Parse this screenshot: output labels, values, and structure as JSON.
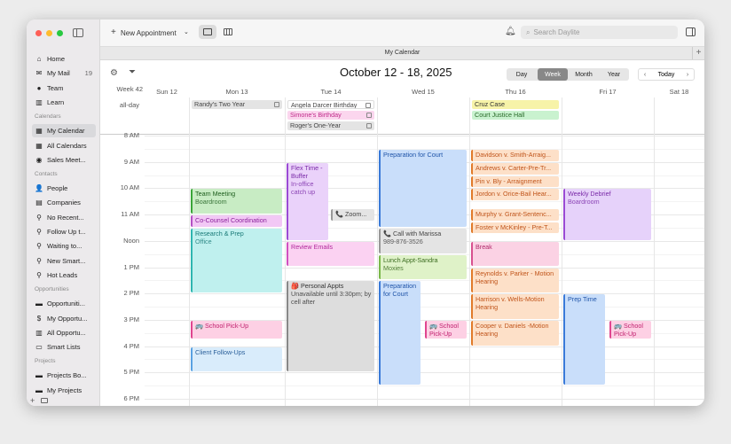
{
  "toolbar": {
    "new_appt": "New Appointment",
    "search_placeholder": "Search Daylite"
  },
  "tab": "My Calendar",
  "header": {
    "title": "October 12 - 18, 2025",
    "views": [
      "Day",
      "Week",
      "Month",
      "Year"
    ],
    "today": "Today"
  },
  "sidebar": {
    "items": [
      {
        "label": "Home",
        "icon": "⌂"
      },
      {
        "label": "My Mail",
        "icon": "✉",
        "count": "19"
      },
      {
        "label": "Team",
        "icon": "●"
      },
      {
        "label": "Learn",
        "icon": "▥"
      }
    ],
    "calendars_head": "Calendars",
    "calendars": [
      {
        "label": "My Calendar",
        "icon": "▦"
      },
      {
        "label": "All Calendars",
        "icon": "▦"
      },
      {
        "label": "Sales Meet...",
        "icon": "◉"
      }
    ],
    "contacts_head": "Contacts",
    "contacts": [
      {
        "label": "People",
        "icon": "👤"
      },
      {
        "label": "Companies",
        "icon": "▤"
      },
      {
        "label": "No Recent...",
        "icon": "⚲"
      },
      {
        "label": "Follow Up t...",
        "icon": "⚲"
      },
      {
        "label": "Waiting to...",
        "icon": "⚲"
      },
      {
        "label": "New Smart...",
        "icon": "⚲"
      },
      {
        "label": "Hot Leads",
        "icon": "⚲"
      }
    ],
    "opps_head": "Opportunities",
    "opps": [
      {
        "label": "Opportuniti...",
        "icon": "▬"
      },
      {
        "label": "My Opportu...",
        "icon": "$"
      },
      {
        "label": "All Opportu...",
        "icon": "▥"
      },
      {
        "label": "Smart Lists",
        "icon": "▭"
      }
    ],
    "projects_head": "Projects",
    "projects": [
      {
        "label": "Projects Bo...",
        "icon": "▬"
      },
      {
        "label": "My Projects",
        "icon": "▬"
      }
    ]
  },
  "week_label": "Week 42",
  "days": [
    "Sun 12",
    "Mon 13",
    "Tue 14",
    "Wed 15",
    "Thu 16",
    "Fri 17",
    "Sat 18"
  ],
  "allday_label": "all-day",
  "hours": [
    "8 AM",
    "9 AM",
    "10 AM",
    "11 AM",
    "Noon",
    "1 PM",
    "2 PM",
    "3 PM",
    "4 PM",
    "5 PM",
    "6 PM"
  ],
  "allday_events": [
    {
      "day": 1,
      "row": 0,
      "title": "Randy's Two Year",
      "color": "#e4e4e4",
      "text": "#444",
      "check": true
    },
    {
      "day": 2,
      "row": 0,
      "title": "Angela Darcer Birthday",
      "color": "#ffffff",
      "text": "#444",
      "check": true
    },
    {
      "day": 2,
      "row": 1,
      "title": "Simone's Birthday",
      "color": "#fbd6ee",
      "text": "#c02a8a",
      "check": true
    },
    {
      "day": 2,
      "row": 2,
      "title": "Roger's One-Year",
      "color": "#e4e4e4",
      "text": "#444",
      "check": true
    },
    {
      "day": 4,
      "row": 0,
      "title": "Cruz Case",
      "color": "#f7f3a8",
      "text": "#333",
      "check": false
    },
    {
      "day": 4,
      "row": 1,
      "title": "Court  Justice Hall",
      "color": "#c9f2cf",
      "text": "#2a6a2a",
      "check": false
    }
  ],
  "events": [
    {
      "day": 1,
      "start": 10.0,
      "end": 11.0,
      "title": "Team Meeting",
      "sub": "Boardroom",
      "bg": "#c8ecc4",
      "fg": "#1f5f1f",
      "bar": "#3aa53a"
    },
    {
      "day": 1,
      "start": 11.0,
      "end": 11.5,
      "title": "Co-Counsel Coordination",
      "sub": "",
      "bg": "#f2c8f5",
      "fg": "#8a1f9a",
      "bar": "#b44fc4"
    },
    {
      "day": 1,
      "start": 11.5,
      "end": 14.0,
      "title": "Research & Prep",
      "sub": "Office",
      "bg": "#bff0ee",
      "fg": "#1a7a78",
      "bar": "#2fb6b0"
    },
    {
      "day": 1,
      "start": 15.0,
      "end": 15.75,
      "title": "🚌 School Pick-Up",
      "sub": "",
      "bg": "#fdd0e4",
      "fg": "#c0206e",
      "bar": "#e0458f"
    },
    {
      "day": 1,
      "start": 16.0,
      "end": 17.0,
      "title": "Client Follow-Ups",
      "sub": "",
      "bg": "#d9ecfb",
      "fg": "#2a5f9a",
      "bar": "#5aa2e2"
    },
    {
      "day": 2,
      "start": 9.0,
      "end": 12.0,
      "title": "Flex Time - Buffer",
      "sub": "In-office catch up",
      "bg": "#ead2fa",
      "fg": "#7a2aa8",
      "bar": "#9a4ad4",
      "w": 0.48
    },
    {
      "day": 2,
      "start": 10.75,
      "end": 11.25,
      "title": "📞 Zoom...",
      "sub": "",
      "bg": "#e4e4e4",
      "fg": "#444",
      "bar": "#999",
      "x": 0.5,
      "w": 0.5
    },
    {
      "day": 2,
      "start": 12.0,
      "end": 13.0,
      "title": "Review Emails",
      "sub": "",
      "bg": "#fbd2f2",
      "fg": "#b0289a",
      "bar": "#d050c0"
    },
    {
      "day": 2,
      "start": 13.5,
      "end": 17.0,
      "title": "🎒 Personal Appts",
      "sub": "Unavailable until 3:30pm; by cell after",
      "bg": "#dddddd",
      "fg": "#333",
      "bar": "#888"
    },
    {
      "day": 3,
      "start": 8.5,
      "end": 11.5,
      "title": "Preparation for Court",
      "sub": "",
      "bg": "#c9defa",
      "fg": "#1f54a8",
      "bar": "#3a7ad8"
    },
    {
      "day": 3,
      "start": 11.5,
      "end": 12.5,
      "title": "📞 Call with Marissa",
      "sub": "989-876-3526",
      "bg": "#e4e4e4",
      "fg": "#444",
      "bar": "#999"
    },
    {
      "day": 3,
      "start": 12.5,
      "end": 13.5,
      "title": "Lunch Appt-Sandra",
      "sub": "Moxies",
      "bg": "#dff2c8",
      "fg": "#3a6a1f",
      "bar": "#7ab84a"
    },
    {
      "day": 3,
      "start": 13.5,
      "end": 17.5,
      "title": "Preparation for Court",
      "sub": "",
      "bg": "#c9defa",
      "fg": "#1f54a8",
      "bar": "#3a7ad8",
      "w": 0.48
    },
    {
      "day": 3,
      "start": 15.0,
      "end": 15.75,
      "title": "🚌 School Pick-Up",
      "sub": "",
      "bg": "#fdd0e4",
      "fg": "#c0206e",
      "bar": "#e0458f",
      "x": 0.52,
      "w": 0.48
    },
    {
      "day": 4,
      "start": 8.5,
      "end": 9.0,
      "title": "Davidson v. Smith-Arraig...",
      "sub": "",
      "bg": "#fde0c8",
      "fg": "#c0541a",
      "bar": "#e07a2a"
    },
    {
      "day": 4,
      "start": 9.0,
      "end": 9.5,
      "title": "Andrews v. Carter-Pre-Tr...",
      "sub": "",
      "bg": "#fde0c8",
      "fg": "#c0541a",
      "bar": "#e07a2a"
    },
    {
      "day": 4,
      "start": 9.5,
      "end": 10.0,
      "title": "Pin v. Bly - Arraignment",
      "sub": "",
      "bg": "#fde0c8",
      "fg": "#c0541a",
      "bar": "#e07a2a"
    },
    {
      "day": 4,
      "start": 10.0,
      "end": 10.5,
      "title": "Jordon v. Orice-Bail Hear...",
      "sub": "",
      "bg": "#fde0c8",
      "fg": "#c0541a",
      "bar": "#e07a2a"
    },
    {
      "day": 4,
      "start": 10.75,
      "end": 11.25,
      "title": "Murphy v. Grant-Sentenc...",
      "sub": "",
      "bg": "#fde0c8",
      "fg": "#c0541a",
      "bar": "#e07a2a"
    },
    {
      "day": 4,
      "start": 11.25,
      "end": 11.75,
      "title": "Foster v McKinley - Pre-T...",
      "sub": "",
      "bg": "#fde0c8",
      "fg": "#c0541a",
      "bar": "#e07a2a"
    },
    {
      "day": 4,
      "start": 12.0,
      "end": 13.0,
      "title": "Break",
      "sub": "",
      "bg": "#fbd2e4",
      "fg": "#b02a6a",
      "bar": "#d8508f"
    },
    {
      "day": 4,
      "start": 13.0,
      "end": 14.0,
      "title": "Reynolds v. Parker - Motion Hearing",
      "sub": "",
      "bg": "#fde0c8",
      "fg": "#c0541a",
      "bar": "#e07a2a"
    },
    {
      "day": 4,
      "start": 14.0,
      "end": 15.0,
      "title": "Harrison v. Wells-Motion Hearing",
      "sub": "",
      "bg": "#fde0c8",
      "fg": "#c0541a",
      "bar": "#e07a2a"
    },
    {
      "day": 4,
      "start": 15.0,
      "end": 16.0,
      "title": "Cooper v. Daniels -Motion Hearing",
      "sub": "",
      "bg": "#fde0c8",
      "fg": "#c0541a",
      "bar": "#e07a2a"
    },
    {
      "day": 5,
      "start": 10.0,
      "end": 12.0,
      "title": "Weekly Debrief",
      "sub": "Boardroom",
      "bg": "#e6d2fa",
      "fg": "#7a2aa8",
      "bar": "#9a4ad4"
    },
    {
      "day": 5,
      "start": 14.0,
      "end": 17.5,
      "title": "Prep Time",
      "sub": "",
      "bg": "#c9defa",
      "fg": "#1f54a8",
      "bar": "#3a7ad8",
      "w": 0.48
    },
    {
      "day": 5,
      "start": 15.0,
      "end": 15.75,
      "title": "🚌 School Pick-Up",
      "sub": "",
      "bg": "#fdd0e4",
      "fg": "#c0206e",
      "bar": "#e0458f",
      "x": 0.52,
      "w": 0.48
    }
  ]
}
